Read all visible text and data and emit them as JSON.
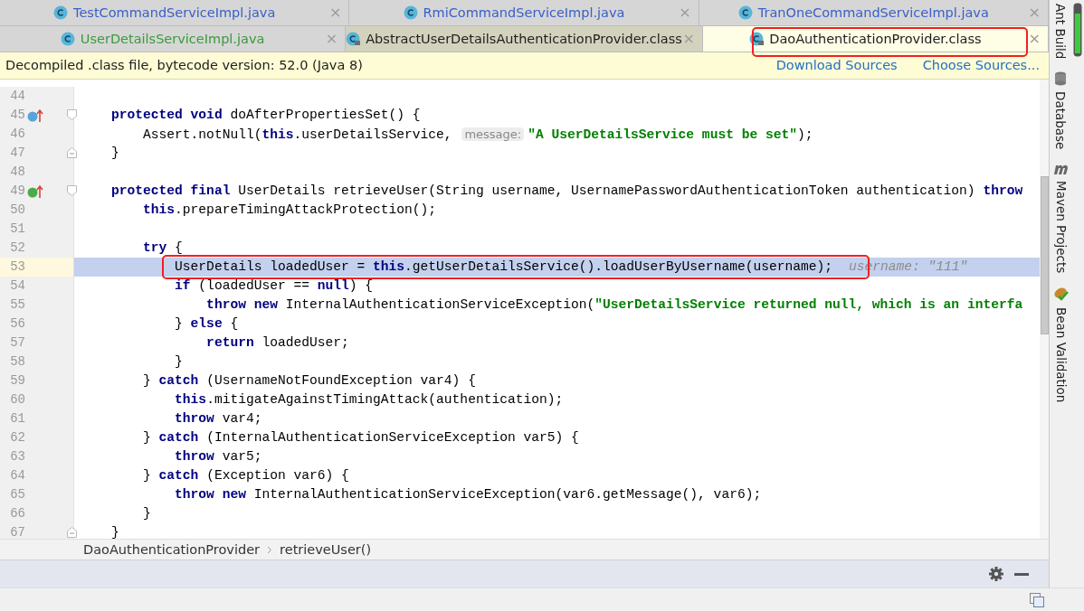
{
  "tab_rows": [
    [
      {
        "label": "TestCommandServiceImpl.java",
        "color": "#3a5fc8",
        "locked": false,
        "selected": false,
        "close": "×"
      },
      {
        "label": "RmiCommandServiceImpl.java",
        "color": "#3a5fc8",
        "locked": false,
        "selected": false,
        "close": "×"
      },
      {
        "label": "TranOneCommandServiceImpl.java",
        "color": "#3a5fc8",
        "locked": false,
        "selected": false,
        "close": "×"
      }
    ],
    [
      {
        "label": "UserDetailsServiceImpl.java",
        "color": "#3c9a3c",
        "locked": false,
        "selected": false,
        "close": "×"
      },
      {
        "label": "AbstractUserDetailsAuthenticationProvider.class",
        "color": "#1e1e1e",
        "locked": true,
        "selected": false,
        "close": "×"
      },
      {
        "label": "DaoAuthenticationProvider.class",
        "color": "#1e1e1e",
        "locked": true,
        "selected": true,
        "close": "×"
      }
    ]
  ],
  "notice": {
    "text": "Decompiled .class file, bytecode version: 52.0 (Java 8)",
    "links": [
      "Download Sources",
      "Choose Sources..."
    ]
  },
  "code_lines": [
    {
      "number": "44",
      "current": false
    },
    {
      "number": "45",
      "current": false,
      "overrides": true,
      "fold_start": true,
      "segments": [
        {
          "kind": "keyword",
          "text": "    protected void"
        },
        {
          "kind": "plain",
          "text": " doAfterPropertiesSet() {"
        }
      ]
    },
    {
      "number": "46",
      "current": false,
      "segments": [
        {
          "kind": "plain",
          "text": "        Assert.notNull("
        },
        {
          "kind": "keyword",
          "text": "this"
        },
        {
          "kind": "plain",
          "text": ".userDetailsService, "
        },
        {
          "kind": "param_hint",
          "text": "message:"
        },
        {
          "kind": "string",
          "text": "\"A UserDetailsService must be set\""
        },
        {
          "kind": "plain",
          "text": ");"
        }
      ]
    },
    {
      "number": "47",
      "current": false,
      "fold_end": true,
      "segments": [
        {
          "kind": "plain",
          "text": "    }"
        }
      ]
    },
    {
      "number": "48",
      "current": false
    },
    {
      "number": "49",
      "current": false,
      "implements": true,
      "fold_start": true,
      "segments": [
        {
          "kind": "keyword",
          "text": "    protected final"
        },
        {
          "kind": "plain",
          "text": " UserDetails retrieveUser(String username, UsernamePasswordAuthenticationToken authentication) "
        },
        {
          "kind": "keyword",
          "text": "throw"
        }
      ]
    },
    {
      "number": "50",
      "current": false,
      "segments": [
        {
          "kind": "keyword",
          "text": "        this"
        },
        {
          "kind": "plain",
          "text": ".prepareTimingAttackProtection();"
        }
      ]
    },
    {
      "number": "51",
      "current": false
    },
    {
      "number": "52",
      "current": false,
      "segments": [
        {
          "kind": "keyword",
          "text": "        try"
        },
        {
          "kind": "plain",
          "text": " {"
        }
      ]
    },
    {
      "number": "53",
      "current": true,
      "segments": [
        {
          "kind": "plain",
          "text": "            UserDetails loadedUser = "
        },
        {
          "kind": "keyword",
          "text": "this"
        },
        {
          "kind": "plain",
          "text": ".getUserDetailsService().loadUserByUsername(username);"
        },
        {
          "kind": "value_hint",
          "text": "username: \"111\""
        }
      ]
    },
    {
      "number": "54",
      "current": false,
      "segments": [
        {
          "kind": "keyword",
          "text": "            if"
        },
        {
          "kind": "plain",
          "text": " (loadedUser == "
        },
        {
          "kind": "keyword",
          "text": "null"
        },
        {
          "kind": "plain",
          "text": ") {"
        }
      ]
    },
    {
      "number": "55",
      "current": false,
      "segments": [
        {
          "kind": "keyword",
          "text": "                throw new"
        },
        {
          "kind": "plain",
          "text": " InternalAuthenticationServiceException("
        },
        {
          "kind": "string",
          "text": "\"UserDetailsService returned null, which is an interfa"
        }
      ]
    },
    {
      "number": "56",
      "current": false,
      "segments": [
        {
          "kind": "plain",
          "text": "            } "
        },
        {
          "kind": "keyword",
          "text": "else"
        },
        {
          "kind": "plain",
          "text": " {"
        }
      ]
    },
    {
      "number": "57",
      "current": false,
      "segments": [
        {
          "kind": "keyword",
          "text": "                return"
        },
        {
          "kind": "plain",
          "text": " loadedUser;"
        }
      ]
    },
    {
      "number": "58",
      "current": false,
      "segments": [
        {
          "kind": "plain",
          "text": "            }"
        }
      ]
    },
    {
      "number": "59",
      "current": false,
      "segments": [
        {
          "kind": "plain",
          "text": "        } "
        },
        {
          "kind": "keyword",
          "text": "catch"
        },
        {
          "kind": "plain",
          "text": " (UsernameNotFoundException var4) {"
        }
      ]
    },
    {
      "number": "60",
      "current": false,
      "segments": [
        {
          "kind": "keyword",
          "text": "            this"
        },
        {
          "kind": "plain",
          "text": ".mitigateAgainstTimingAttack(authentication);"
        }
      ]
    },
    {
      "number": "61",
      "current": false,
      "segments": [
        {
          "kind": "keyword",
          "text": "            throw"
        },
        {
          "kind": "plain",
          "text": " var4;"
        }
      ]
    },
    {
      "number": "62",
      "current": false,
      "segments": [
        {
          "kind": "plain",
          "text": "        } "
        },
        {
          "kind": "keyword",
          "text": "catch"
        },
        {
          "kind": "plain",
          "text": " (InternalAuthenticationServiceException var5) {"
        }
      ]
    },
    {
      "number": "63",
      "current": false,
      "segments": [
        {
          "kind": "keyword",
          "text": "            throw"
        },
        {
          "kind": "plain",
          "text": " var5;"
        }
      ]
    },
    {
      "number": "64",
      "current": false,
      "segments": [
        {
          "kind": "plain",
          "text": "        } "
        },
        {
          "kind": "keyword",
          "text": "catch"
        },
        {
          "kind": "plain",
          "text": " (Exception var6) {"
        }
      ]
    },
    {
      "number": "65",
      "current": false,
      "segments": [
        {
          "kind": "keyword",
          "text": "            throw new"
        },
        {
          "kind": "plain",
          "text": " InternalAuthenticationServiceException(var6.getMessage(), var6);"
        }
      ]
    },
    {
      "number": "66",
      "current": false,
      "segments": [
        {
          "kind": "plain",
          "text": "        }"
        }
      ]
    },
    {
      "number": "67",
      "current": false,
      "fold_end": true,
      "segments": [
        {
          "kind": "plain",
          "text": "    }"
        }
      ]
    }
  ],
  "breadcrumb": [
    "DaoAuthenticationProvider",
    "retrieveUser()"
  ],
  "side_panel": [
    {
      "label": "Ant Build",
      "kind": "ant"
    },
    {
      "label": "Database",
      "kind": "database"
    },
    {
      "label": "Maven Projects",
      "kind": "maven"
    },
    {
      "label": "Bean Validation",
      "kind": "bean"
    }
  ]
}
